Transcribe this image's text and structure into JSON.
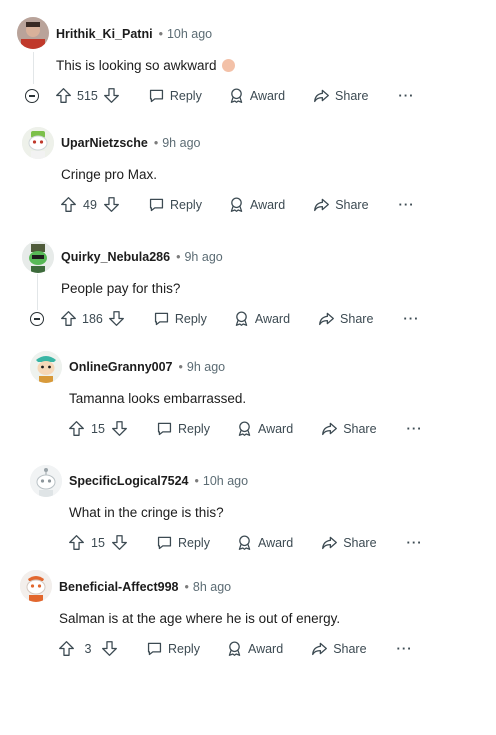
{
  "actions": {
    "reply": "Reply",
    "award": "Award",
    "share": "Share",
    "more": "···"
  },
  "comments": [
    {
      "author": "Hrithik_Ki_Patni",
      "time": "10h ago",
      "text": "This is looking so awkward",
      "votes": "515"
    },
    {
      "author": "UparNietzsche",
      "time": "9h ago",
      "text": "Cringe pro Max.",
      "votes": "49"
    },
    {
      "author": "Quirky_Nebula286",
      "time": "9h ago",
      "text": "People pay for this?",
      "votes": "186"
    },
    {
      "author": "OnlineGranny007",
      "time": "9h ago",
      "text": "Tamanna looks embarrassed.",
      "votes": "15"
    },
    {
      "author": "SpecificLogical7524",
      "time": "10h ago",
      "text": "What in the cringe is this?",
      "votes": "15"
    },
    {
      "author": "Beneficial-Affect998",
      "time": "8h ago",
      "text": "Salman is at the age where he is out of energy.",
      "votes": "3"
    }
  ],
  "colors": {
    "text": "#1c1c1c",
    "muted": "#5c6c74",
    "action": "#3c4a52"
  }
}
